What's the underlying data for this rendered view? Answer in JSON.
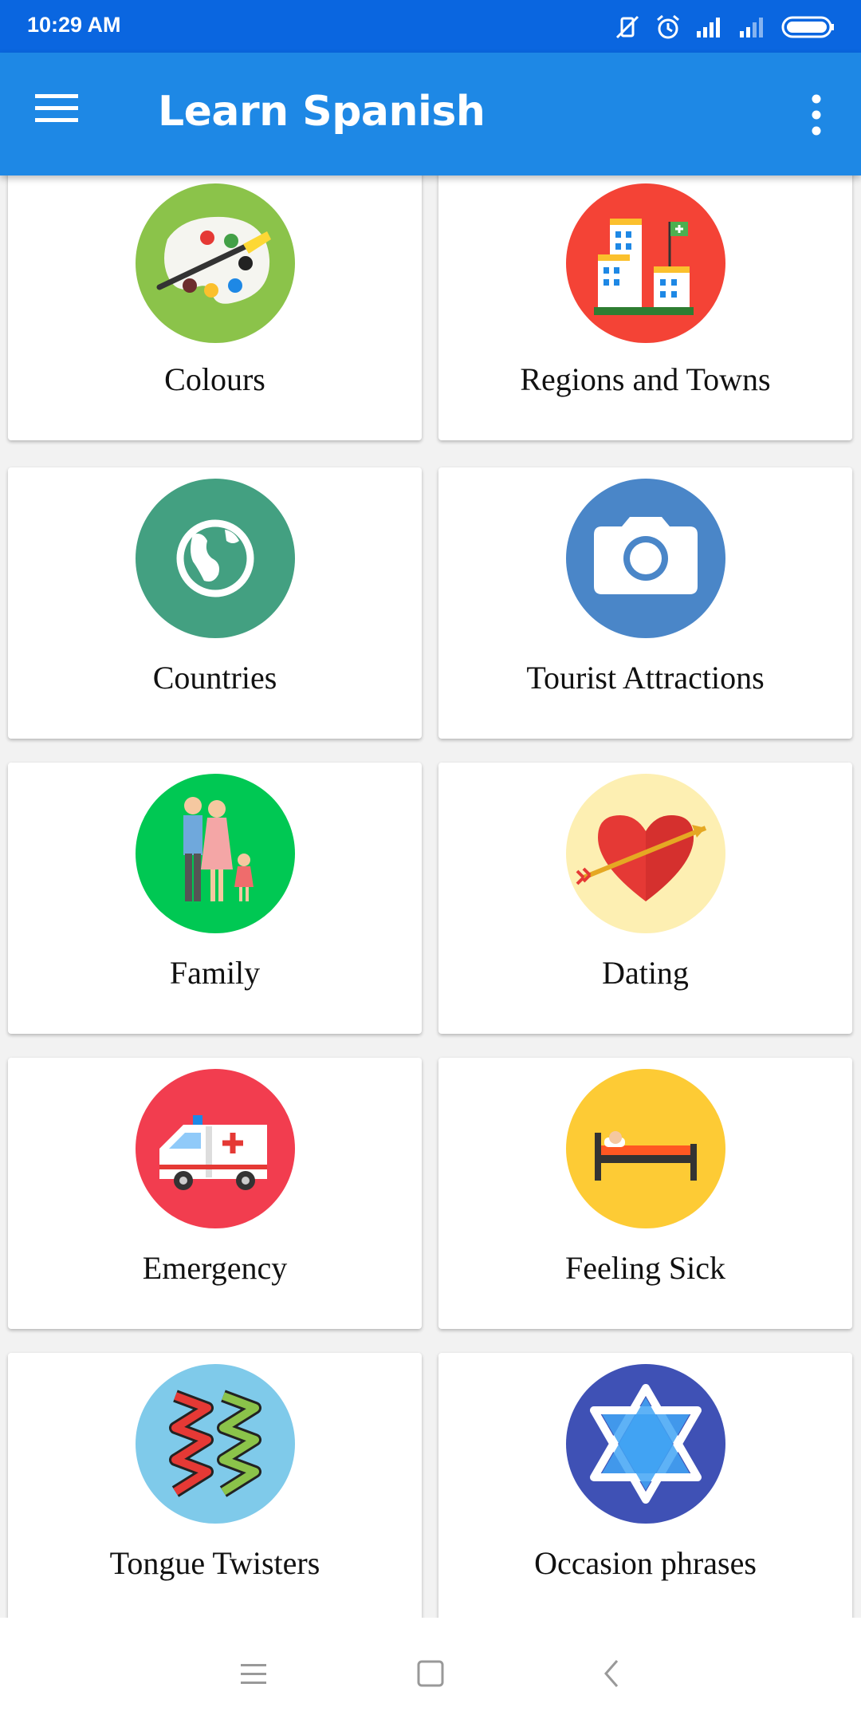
{
  "status_bar": {
    "time": "10:29 AM",
    "icons": [
      "mute-vibrate-icon",
      "alarm-icon",
      "signal-icon",
      "signal-icon-2",
      "battery-icon"
    ]
  },
  "app_bar": {
    "title": "Learn Spanish",
    "menu_icon": "hamburger-menu-icon",
    "more_icon": "more-vertical-icon"
  },
  "categories": [
    {
      "label": "Colours",
      "icon": "palette-icon",
      "color": "#8bc34a"
    },
    {
      "label": "Regions and Towns",
      "icon": "city-buildings-icon",
      "color": "#f44336"
    },
    {
      "label": "Countries",
      "icon": "globe-icon",
      "color": "#43a081"
    },
    {
      "label": "Tourist Attractions",
      "icon": "camera-icon",
      "color": "#4a86c8"
    },
    {
      "label": "Family",
      "icon": "family-icon",
      "color": "#00c853"
    },
    {
      "label": "Dating",
      "icon": "heart-arrow-icon",
      "color": "#fdefb2"
    },
    {
      "label": "Emergency",
      "icon": "ambulance-icon",
      "color": "#f23d4f"
    },
    {
      "label": "Feeling Sick",
      "icon": "sick-bed-icon",
      "color": "#fdcb35"
    },
    {
      "label": "Tongue Twisters",
      "icon": "zigzag-icon",
      "color": "#7fcaea"
    },
    {
      "label": "Occasion phrases",
      "icon": "star-of-david-icon",
      "color": "#3f51b5"
    }
  ],
  "nav_bar": {
    "icons": [
      "recent-apps-icon",
      "home-icon",
      "back-icon"
    ]
  }
}
